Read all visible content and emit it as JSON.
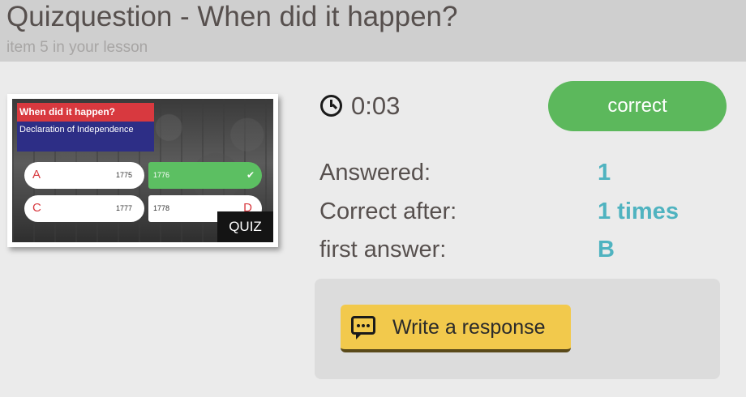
{
  "header": {
    "title": "Quizquestion - When did it happen?",
    "subtitle": "item 5 in your lesson"
  },
  "thumbnail": {
    "question_title": "When did it happen?",
    "question_text": "Declaration of Independence",
    "options": [
      {
        "letter": "A",
        "value": "1775"
      },
      {
        "letter": "B",
        "value": "1776",
        "selected": true
      },
      {
        "letter": "C",
        "value": "1777"
      },
      {
        "letter": "D",
        "value": "1778"
      }
    ],
    "check": "✔",
    "badge": "QUIZ"
  },
  "timer": {
    "icon": "clock-icon",
    "value": "0:03"
  },
  "result": {
    "label": "correct",
    "color": "#5cb85c"
  },
  "stats": {
    "answered_label": "Answered:",
    "answered_value": "1",
    "correct_after_label": "Correct after:",
    "correct_after_value": "1 times",
    "first_answer_label": "first answer:",
    "first_answer_value": "B"
  },
  "response": {
    "button_label": "Write a response",
    "icon": "chat-icon"
  },
  "colors": {
    "accent": "#4fb3c0",
    "button": "#f2c94c",
    "success": "#5cb85c"
  }
}
